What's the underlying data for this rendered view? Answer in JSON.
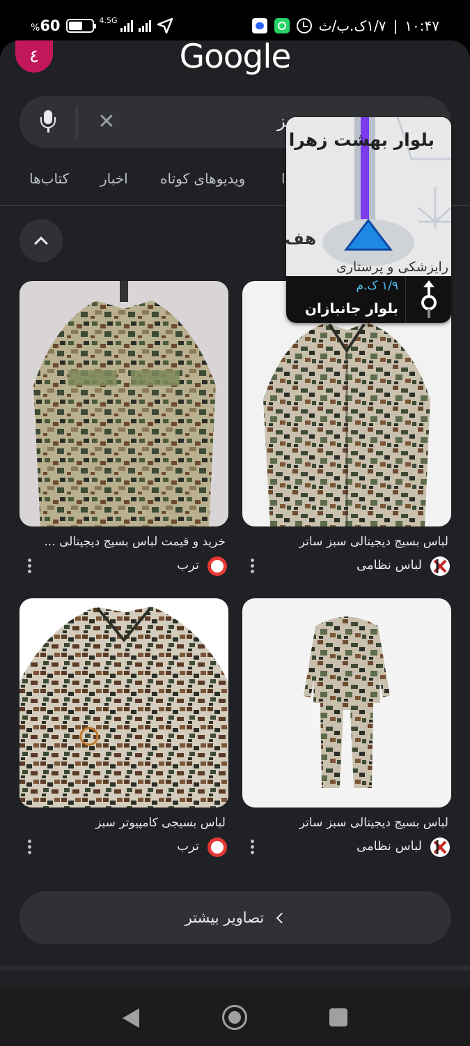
{
  "status_bar": {
    "battery_pct": "60",
    "percent_sign": "%",
    "battery_level": 0.6,
    "network_type": "4.5G",
    "time_text": "۱۰:۴۷",
    "separator": "|",
    "speed_text": "۱/۷ک.ب/ث",
    "icons": [
      "battery-icon",
      "signal-icon",
      "signal-icon",
      "navigation-arrow-icon",
      "chat-notification-icon",
      "whatsapp-icon",
      "alarm-icon"
    ]
  },
  "browser": {
    "tab_count": "٤",
    "logo": "Google"
  },
  "search": {
    "query": "بز",
    "icons": [
      "mic-icon",
      "clear-icon"
    ]
  },
  "tabs": [
    {
      "label": "کتاب‌ها"
    },
    {
      "label": "اخبار"
    },
    {
      "label": "ویدیوهای کوتاه"
    },
    {
      "label": "ا"
    }
  ],
  "results": [
    {
      "caption": "لباس بسیج دیجیتالی سبز ساتر",
      "source": "لباس نظامی",
      "source_icon": "labas-nezami-icon"
    },
    {
      "caption": "خرید و قیمت لباس بسیج دیجیتالی ...",
      "source": "ترب",
      "source_icon": "torob-icon"
    },
    {
      "caption": "لباس بسیج دیجیتالی سبز ساتر",
      "source": "لباس نظامی",
      "source_icon": "labas-nezami-icon"
    },
    {
      "caption": "لباس بسیجی کامپیوتر سبز",
      "source": "ترب",
      "source_icon": "torob-icon"
    }
  ],
  "more_images": {
    "label": "تصاویر بیشتر"
  },
  "nav_overlay": {
    "destination": "بلوار بهشت زهرا",
    "place_label": "رایزشکی و پرستاری",
    "place_label_2": "هف",
    "distance": "۱/۹ ک.م",
    "street": "بلوار جانبازان"
  },
  "colors": {
    "background": "#202124",
    "search_bg": "#303134",
    "tab_badge": "#c2185b",
    "nav_distance": "#4fc3f7",
    "route_purple": "#7c3aed",
    "nav_arrow": "#1e88e5"
  }
}
